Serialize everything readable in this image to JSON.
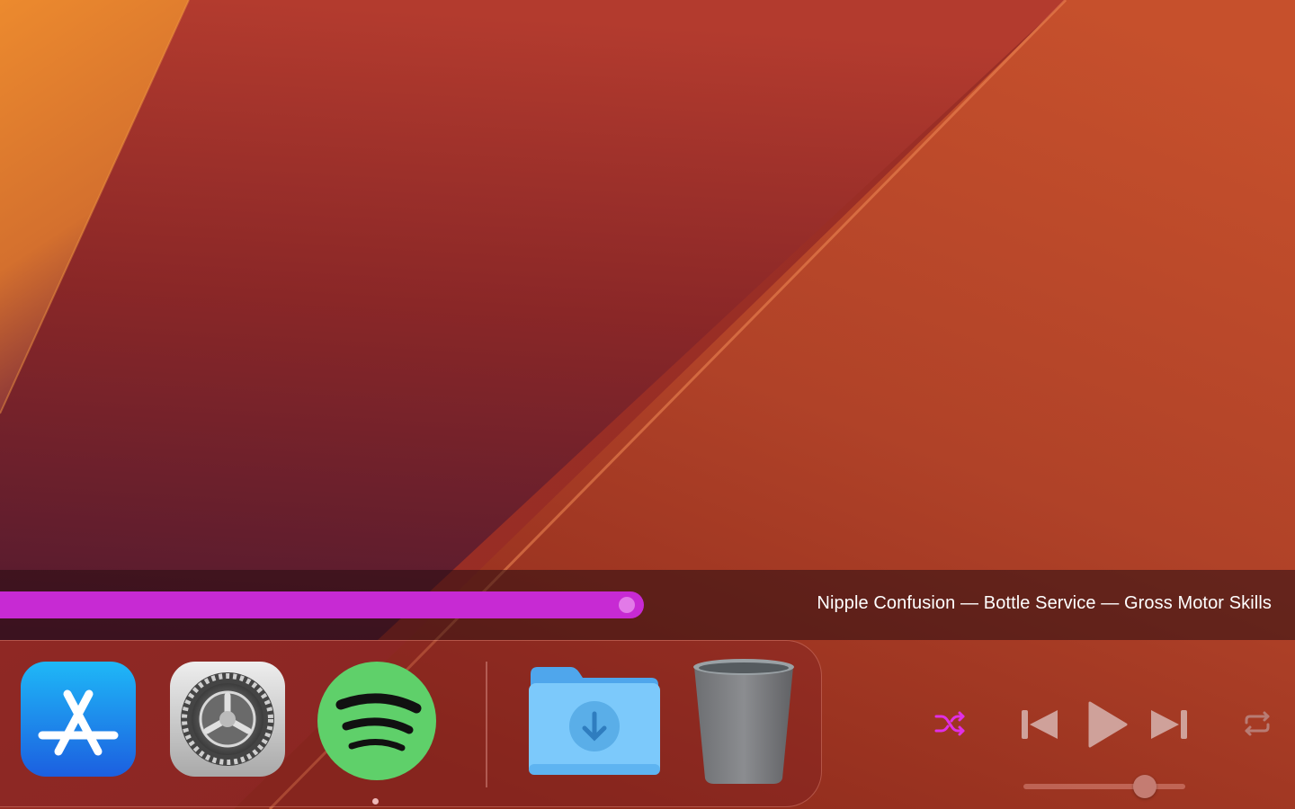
{
  "now_playing": {
    "title": "Nipple Confusion — Bottle Service — Gross Motor Skills",
    "progress_fraction": 0.497,
    "accent_color": "#c72ad3"
  },
  "dock": {
    "apps": [
      {
        "name": "App Store",
        "icon": "app-store-icon"
      },
      {
        "name": "System Settings",
        "icon": "gear-icon"
      },
      {
        "name": "Spotify",
        "icon": "spotify-icon",
        "running": true
      },
      {
        "name": "Downloads",
        "icon": "downloads-folder-icon"
      },
      {
        "name": "Trash",
        "icon": "trash-icon"
      }
    ]
  },
  "controls": {
    "shuffle": {
      "icon": "shuffle-icon",
      "active": true,
      "color": "#e02fe6"
    },
    "previous": {
      "icon": "previous-track-icon"
    },
    "play": {
      "icon": "play-icon"
    },
    "next": {
      "icon": "next-track-icon"
    },
    "repeat": {
      "icon": "repeat-icon",
      "active": false
    },
    "volume_fraction": 0.75
  }
}
